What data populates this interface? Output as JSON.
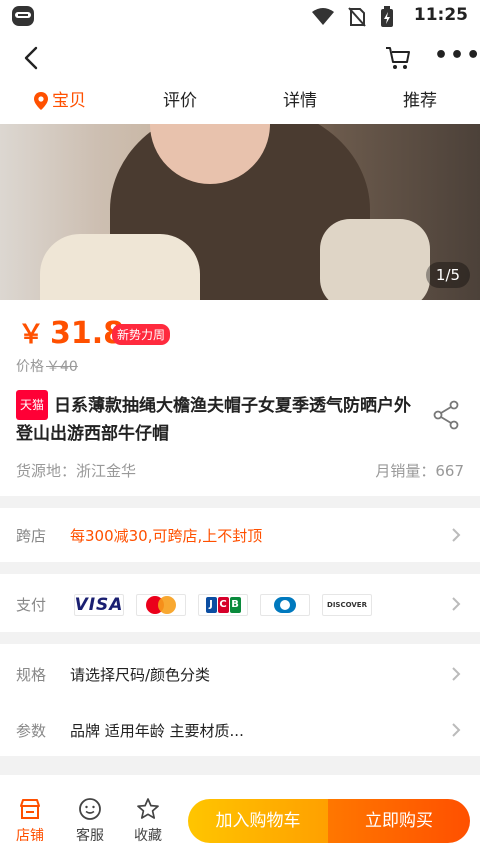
{
  "status": {
    "time": "11:25"
  },
  "nav": {
    "tabs": [
      "宝贝",
      "评价",
      "详情",
      "推荐"
    ]
  },
  "gallery": {
    "counter": "1/5"
  },
  "product": {
    "currency": "￥",
    "price": "31.8",
    "badge": "新势力周",
    "old_price_label": "价格",
    "old_price": "￥40",
    "tmall_tag": "天猫",
    "title": "日系薄款抽绳大檐渔夫帽子女夏季透气防晒户外登山出游西部牛仔帽",
    "origin": "货源地：浙江金华",
    "sales": "月销量：667"
  },
  "promo": {
    "label": "跨店",
    "value": "每300减30,可跨店,上不封顶"
  },
  "payment": {
    "label": "支付",
    "cards": [
      "VISA",
      "Mastercard",
      "JCB",
      "Diners Club",
      "DISCOVER"
    ],
    "visa_text": "VISA",
    "discover_text": "DISCOVER",
    "jcb_letters": [
      "J",
      "C",
      "B"
    ]
  },
  "specs": {
    "spec_label": "规格",
    "spec_value": "请选择尺码/颜色分类",
    "param_label": "参数",
    "param_value": "品牌 适用年龄 主要材质..."
  },
  "bottom": {
    "shop": "店铺",
    "service": "客服",
    "favorite": "收藏",
    "add_to_cart": "加入购物车",
    "buy_now": "立即购买"
  },
  "colors": {
    "accent": "#ff5000",
    "tmall": "#ff0036",
    "cart_btn": "#ffb000"
  }
}
